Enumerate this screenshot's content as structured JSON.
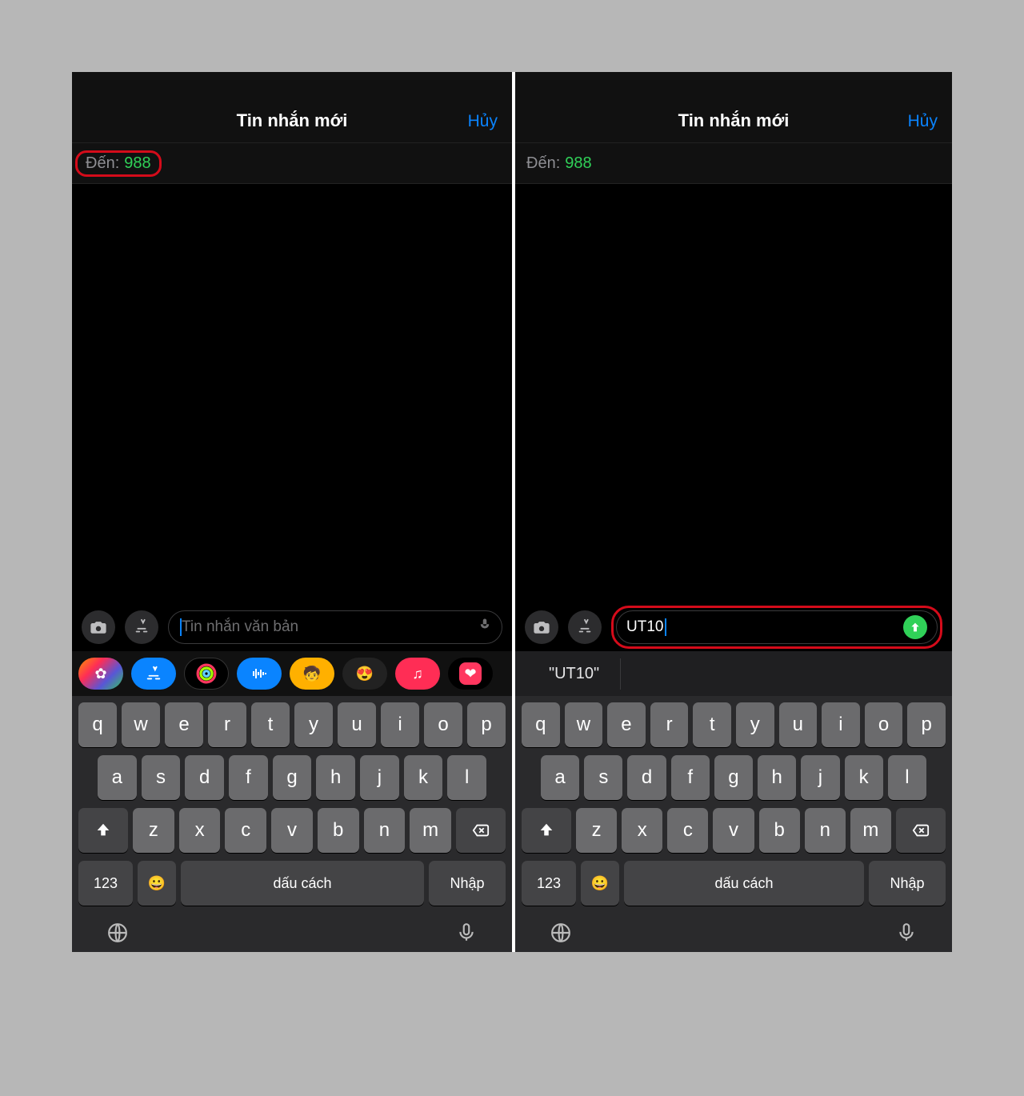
{
  "header": {
    "title": "Tin nhắn mới",
    "cancel": "Hủy"
  },
  "to": {
    "label": "Đến:",
    "value": "988"
  },
  "left": {
    "placeholder": "Tin nhắn văn bản",
    "value": ""
  },
  "right": {
    "value": "UT10",
    "suggestion": "\"UT10\""
  },
  "keyboard": {
    "row1": [
      "q",
      "w",
      "e",
      "r",
      "t",
      "y",
      "u",
      "i",
      "o",
      "p"
    ],
    "row2": [
      "a",
      "s",
      "d",
      "f",
      "g",
      "h",
      "j",
      "k",
      "l"
    ],
    "row3": [
      "z",
      "x",
      "c",
      "v",
      "b",
      "n",
      "m"
    ],
    "n123": "123",
    "space": "dấu cách",
    "enter": "Nhập",
    "emoji": "😀"
  },
  "apps": [
    "photos",
    "appstore",
    "fitness",
    "voice",
    "memoji1",
    "memoji2",
    "music",
    "heart"
  ]
}
